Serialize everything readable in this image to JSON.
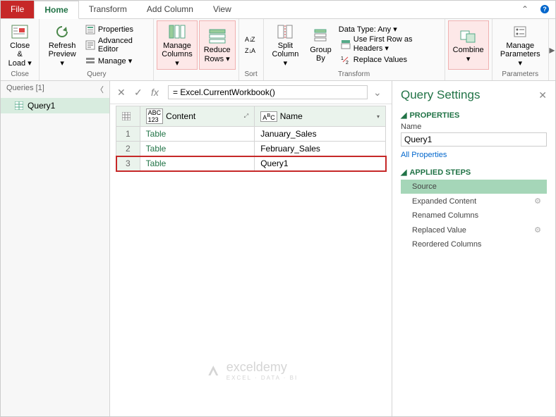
{
  "tabs": {
    "file": "File",
    "home": "Home",
    "transform": "Transform",
    "add_column": "Add Column",
    "view": "View"
  },
  "ribbon": {
    "close": {
      "label": "Close &\nLoad ▾",
      "group": "Close"
    },
    "query_group": {
      "refresh": "Refresh\nPreview ▾",
      "properties": "Properties",
      "adv_editor": "Advanced Editor",
      "manage": "Manage ▾",
      "group": "Query"
    },
    "manage_cols": "Manage\nColumns ▾",
    "reduce_rows": "Reduce\nRows ▾",
    "sort_group": "Sort",
    "split_col": "Split\nColumn ▾",
    "group_by": "Group\nBy",
    "transform_group": {
      "datatype": "Data Type: Any ▾",
      "first_row": "Use First Row as Headers ▾",
      "replace": "Replace Values",
      "group": "Transform"
    },
    "combine": "Combine\n▾",
    "params": {
      "label": "Manage\nParameters ▾",
      "group": "Parameters"
    }
  },
  "left": {
    "header": "Queries [1]",
    "query_name": "Query1"
  },
  "formula": "= Excel.CurrentWorkbook()",
  "table": {
    "col1": "Content",
    "col2": "Name",
    "rows": [
      {
        "n": "1",
        "content": "Table",
        "name": "January_Sales"
      },
      {
        "n": "2",
        "content": "Table",
        "name": "February_Sales"
      },
      {
        "n": "3",
        "content": "Table",
        "name": "Query1"
      }
    ]
  },
  "watermark": {
    "text": "exceldemy",
    "sub": "EXCEL · DATA · BI"
  },
  "settings": {
    "title": "Query Settings",
    "properties": "PROPERTIES",
    "name_label": "Name",
    "name_value": "Query1",
    "all_props": "All Properties",
    "applied": "APPLIED STEPS",
    "steps": [
      "Source",
      "Expanded Content",
      "Renamed Columns",
      "Replaced Value",
      "Reordered Columns"
    ]
  }
}
